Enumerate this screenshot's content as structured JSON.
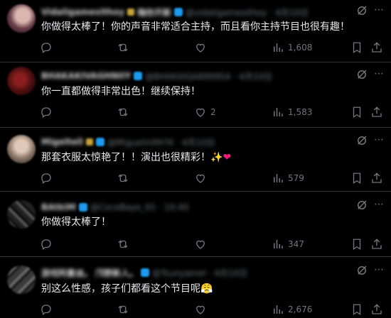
{
  "colors": {
    "background": "#000000",
    "text": "#e7e9ea",
    "muted": "#71767b",
    "divider": "#2f3336",
    "verified_blue": "#1d9bf0"
  },
  "icons": {
    "reply": "reply-icon",
    "repost": "repost-icon",
    "like": "like-icon",
    "views": "views-icon",
    "bookmark": "bookmark-icon",
    "share": "share-icon",
    "grok": "grok-icon",
    "more": "more-icon"
  },
  "posts": [
    {
      "name": "Vidaligamesithoy",
      "name_suffix": "嗨你开新",
      "handle": "@vidaligamesithoy · 4月10日",
      "text": "你做得太棒了！你的声音非常适合主持，而且看你主持节目也很有趣！",
      "replies": "",
      "reposts": "",
      "likes": "",
      "views": "1,608"
    },
    {
      "name": "BHAKAKIVAGHNIIY",
      "name_suffix": "",
      "handle": "@BHAKAIQA899954 · 4月10日",
      "text": "你一直都做得非常出色！继续保持！",
      "replies": "",
      "reposts": "",
      "likes": "2",
      "views": "1,583"
    },
    {
      "name": "Migeltell",
      "name_suffix": "",
      "handle": "@Miguelin9976 · 4月10日",
      "text": "那套衣服太惊艳了！！演出也很精彩！✨",
      "text_heart": "❤",
      "replies": "",
      "reposts": "",
      "likes": "",
      "views": "579"
    },
    {
      "name": "BAtkIM",
      "name_suffix": "",
      "handle": "@CocoBaye_01 · 10:40",
      "text": "你做得太棒了！",
      "replies": "",
      "reposts": "",
      "likes": "",
      "views": "347"
    },
    {
      "name": "游戏阿曼迪。",
      "name_suffix": "邝野新人。",
      "handle": "@Tsunyamel · 4月10日",
      "text": "别这么性感，孩子们都看这个节目呢😤",
      "replies": "",
      "reposts": "",
      "likes": "",
      "views": "2,676"
    }
  ]
}
